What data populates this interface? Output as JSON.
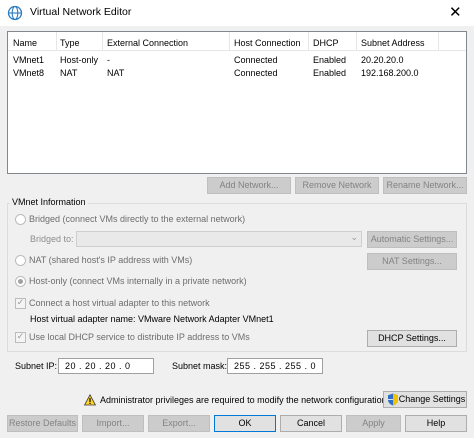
{
  "window": {
    "title": "Virtual Network Editor"
  },
  "table": {
    "columns": [
      "Name",
      "Type",
      "External Connection",
      "Host Connection",
      "DHCP",
      "Subnet Address"
    ],
    "rows": [
      [
        "VMnet1",
        "Host-only",
        "-",
        "Connected",
        "Enabled",
        "20.20.20.0"
      ],
      [
        "VMnet8",
        "NAT",
        "NAT",
        "Connected",
        "Enabled",
        "192.168.200.0"
      ]
    ]
  },
  "network_buttons": {
    "add": "Add Network...",
    "remove": "Remove Network",
    "rename": "Rename Network..."
  },
  "vmnet_info": {
    "title": "VMnet Information",
    "bridged_label": "Bridged (connect VMs directly to the external network)",
    "bridged_to_label": "Bridged to:",
    "bridged_to_value": "",
    "automatic_settings": "Automatic Settings...",
    "nat_label": "NAT (shared host's IP address with VMs)",
    "nat_settings": "NAT Settings...",
    "hostonly_label": "Host-only (connect VMs internally in a private network)",
    "selected_mode": "Host-only",
    "connect_adapter_label": "Connect a host virtual adapter to this network",
    "connect_adapter_checked": true,
    "adapter_name_label": "Host virtual adapter name: VMware Network Adapter VMnet1",
    "dhcp_label": "Use local DHCP service to distribute IP address to VMs",
    "dhcp_checked": true,
    "dhcp_settings": "DHCP Settings..."
  },
  "subnet": {
    "ip_label": "Subnet IP:",
    "ip_value": "20 . 20 . 20 . 0",
    "mask_label": "Subnet mask:",
    "mask_value": "255 . 255 . 255 . 0"
  },
  "notice": {
    "text": "Administrator privileges are required to modify the network configuration.",
    "change_settings": "Change Settings"
  },
  "footer": {
    "restore": "Restore Defaults",
    "import": "Import...",
    "export": "Export...",
    "ok": "OK",
    "cancel": "Cancel",
    "apply": "Apply",
    "help": "Help"
  }
}
